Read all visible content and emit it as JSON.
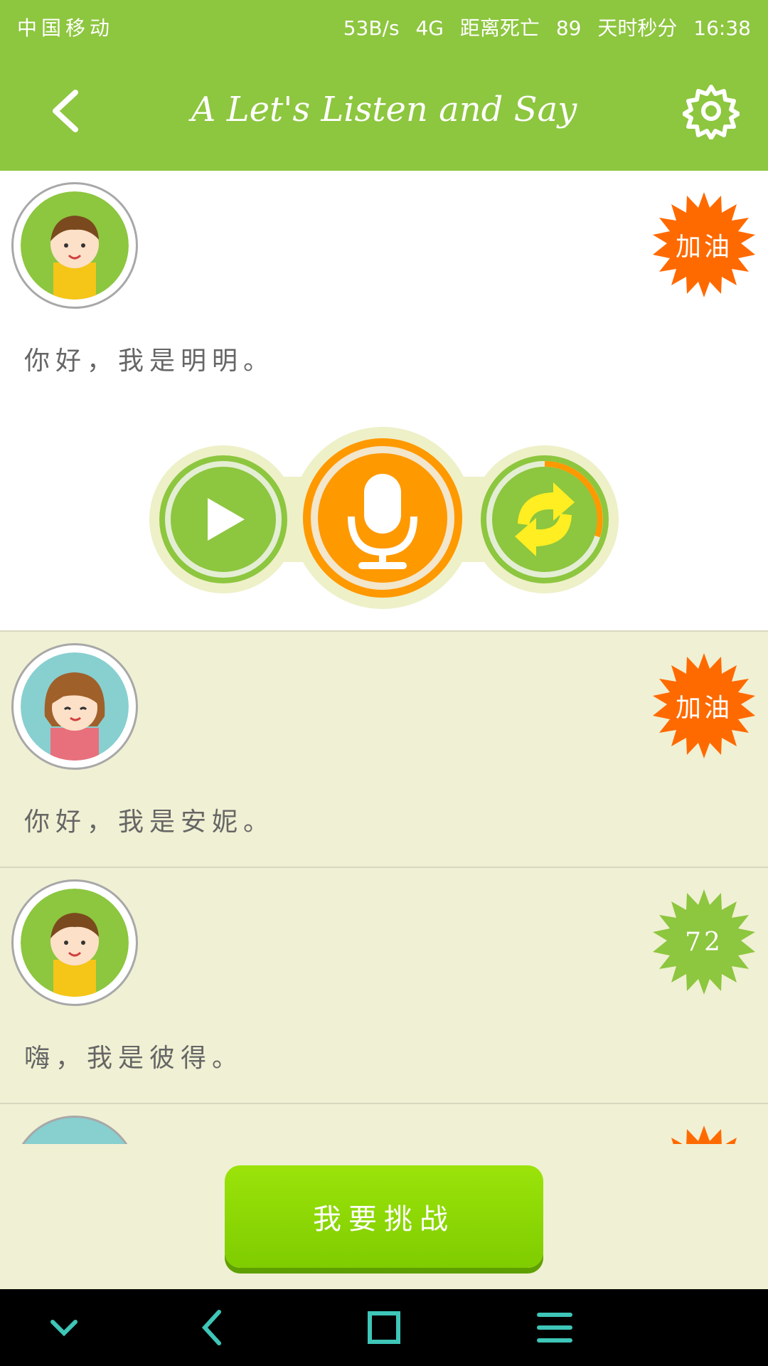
{
  "status_bar": {
    "carrier": "中国移动",
    "speed": "53B/s",
    "network": "4G",
    "banner": "距离死亡",
    "countdown": "89",
    "banner_suffix": "天时秒分",
    "time": "16:38"
  },
  "header": {
    "title": "A Let's Listen and Say",
    "back_icon": "chevron-left-icon",
    "settings_icon": "gear-icon"
  },
  "dialogues": [
    {
      "character": "boy",
      "sentence": "你好，我是明明。",
      "badge": "加油",
      "badge_color": "#ff6a00"
    },
    {
      "character": "girl",
      "sentence": "你好，我是安妮。",
      "badge": "加油",
      "badge_color": "#ff6a00"
    },
    {
      "character": "boy",
      "sentence": "嗨，我是彼得。",
      "badge": "72",
      "badge_color": "#8dc63f"
    }
  ],
  "controls": {
    "play_icon": "play-icon",
    "record_icon": "microphone-icon",
    "replay_icon": "refresh-icon"
  },
  "challenge_button": "我要挑战",
  "nav_bar": [
    "chevron-down-icon",
    "back-icon",
    "square-icon",
    "menu-icon"
  ],
  "colors": {
    "primary": "#8dc63f",
    "accent": "#ff9900",
    "badge_orange": "#ff6a00"
  }
}
